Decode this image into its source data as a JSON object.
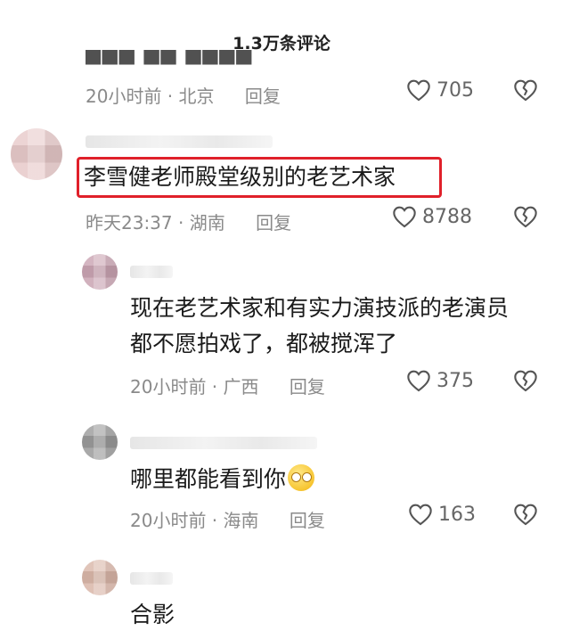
{
  "header": {
    "title": "1.3万条评论"
  },
  "top_comment": {
    "time_location": "20小时前 · 北京",
    "reply_label": "回复",
    "likes": "705"
  },
  "comment": {
    "text": "李雪健老师殿堂级别的老艺术家",
    "time_location": "昨天23:37 · 湖南",
    "reply_label": "回复",
    "likes": "8788"
  },
  "replies": [
    {
      "text_line1": "现在老艺术家和有实力演技派的老演员",
      "text_line2": "都不愿拍戏了，都被搅浑了",
      "time_location": "20小时前 · 广西",
      "reply_label": "回复",
      "likes": "375"
    },
    {
      "text": "哪里都能看到你",
      "time_location": "20小时前 · 海南",
      "reply_label": "回复",
      "likes": "163"
    },
    {
      "text": "合影"
    }
  ],
  "colors": {
    "highlight_border": "#e0202a",
    "meta_text": "#8a8a8a"
  }
}
